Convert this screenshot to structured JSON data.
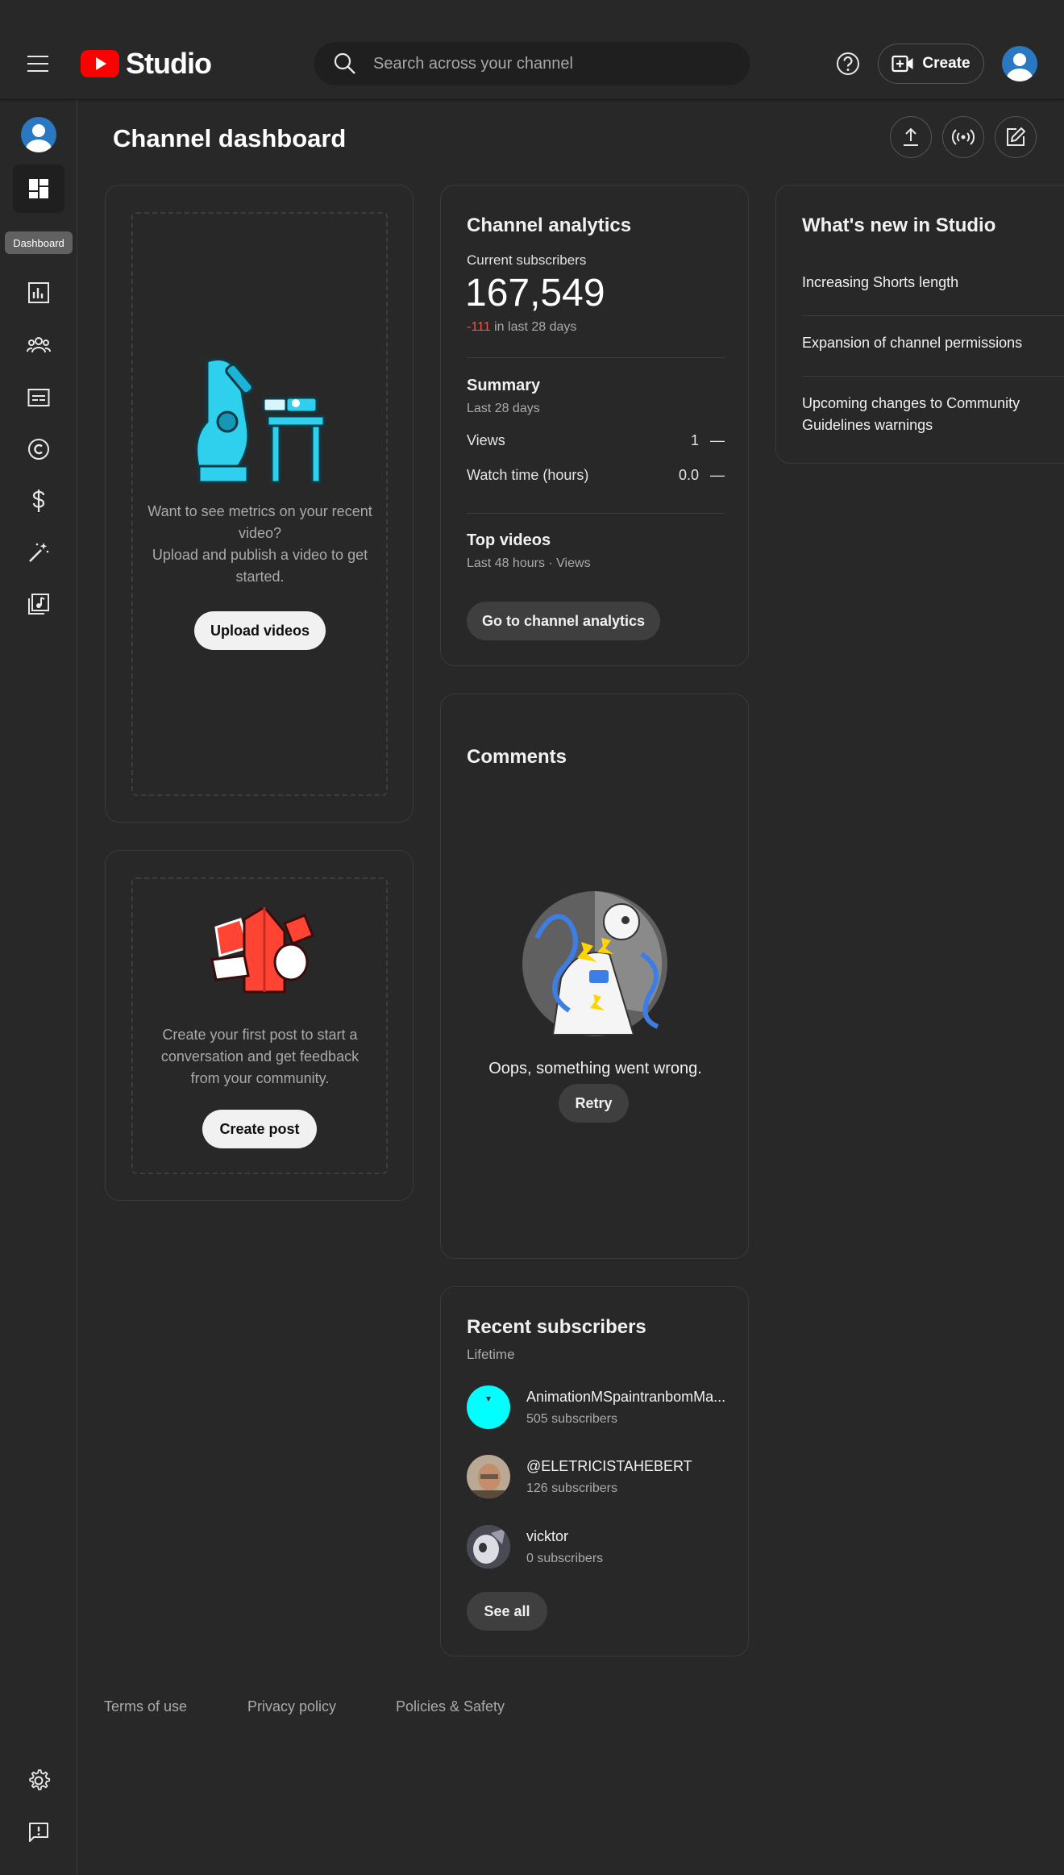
{
  "header": {
    "logo_text": "Studio",
    "search_placeholder": "Search across your channel",
    "create_label": "Create"
  },
  "sidebar": {
    "tooltip": "Dashboard",
    "items": [
      {
        "name": "dashboard",
        "icon": "dashboard-icon"
      },
      {
        "name": "analytics",
        "icon": "analytics-icon"
      },
      {
        "name": "community",
        "icon": "community-icon"
      },
      {
        "name": "subtitles",
        "icon": "subtitles-icon"
      },
      {
        "name": "copyright",
        "icon": "copyright-icon"
      },
      {
        "name": "earn",
        "icon": "dollar-icon"
      },
      {
        "name": "customization",
        "icon": "magic-wand-icon"
      },
      {
        "name": "audio-library",
        "icon": "audio-library-icon"
      }
    ]
  },
  "page": {
    "title": "Channel dashboard"
  },
  "upload_card": {
    "text_line1": "Want to see metrics on your recent video?",
    "text_line2": "Upload and publish a video to get started.",
    "button": "Upload videos"
  },
  "post_card": {
    "text": "Create your first post to start a conversation and get feedback from your community.",
    "button": "Create post"
  },
  "analytics": {
    "title": "Channel analytics",
    "subs_label": "Current subscribers",
    "subs_count": "167,549",
    "subs_change": "-111",
    "subs_change_suffix": "in last 28 days",
    "summary_title": "Summary",
    "summary_period": "Last 28 days",
    "metrics": [
      {
        "label": "Views",
        "value": "1",
        "trend": "—"
      },
      {
        "label": "Watch time (hours)",
        "value": "0.0",
        "trend": "—"
      }
    ],
    "top_videos_title": "Top videos",
    "top_videos_sub": "Last 48 hours · Views",
    "button": "Go to channel analytics"
  },
  "comments": {
    "title": "Comments",
    "error": "Oops, something went wrong.",
    "retry": "Retry"
  },
  "recent_subs": {
    "title": "Recent subscribers",
    "period": "Lifetime",
    "items": [
      {
        "name": "AnimationMSpaintranbomMa...",
        "count": "505 subscribers",
        "color": "#00ffff"
      },
      {
        "name": "@ELETRICISTAHEBERT",
        "count": "126 subscribers",
        "color": "#8a6f5a"
      },
      {
        "name": "vicktor",
        "count": "0 subscribers",
        "color": "#6d6d78"
      }
    ],
    "see_all": "See all"
  },
  "whats_new": {
    "title": "What's new in Studio",
    "items": [
      "Increasing Shorts length",
      "Expansion of channel permissions",
      "Upcoming changes to Community Guidelines warnings"
    ]
  },
  "footer": {
    "links": [
      "Terms of use",
      "Privacy policy",
      "Policies & Safety"
    ]
  },
  "colors": {
    "background": "#282828",
    "accent_red": "#ff0000",
    "negative": "#ff4e45"
  }
}
